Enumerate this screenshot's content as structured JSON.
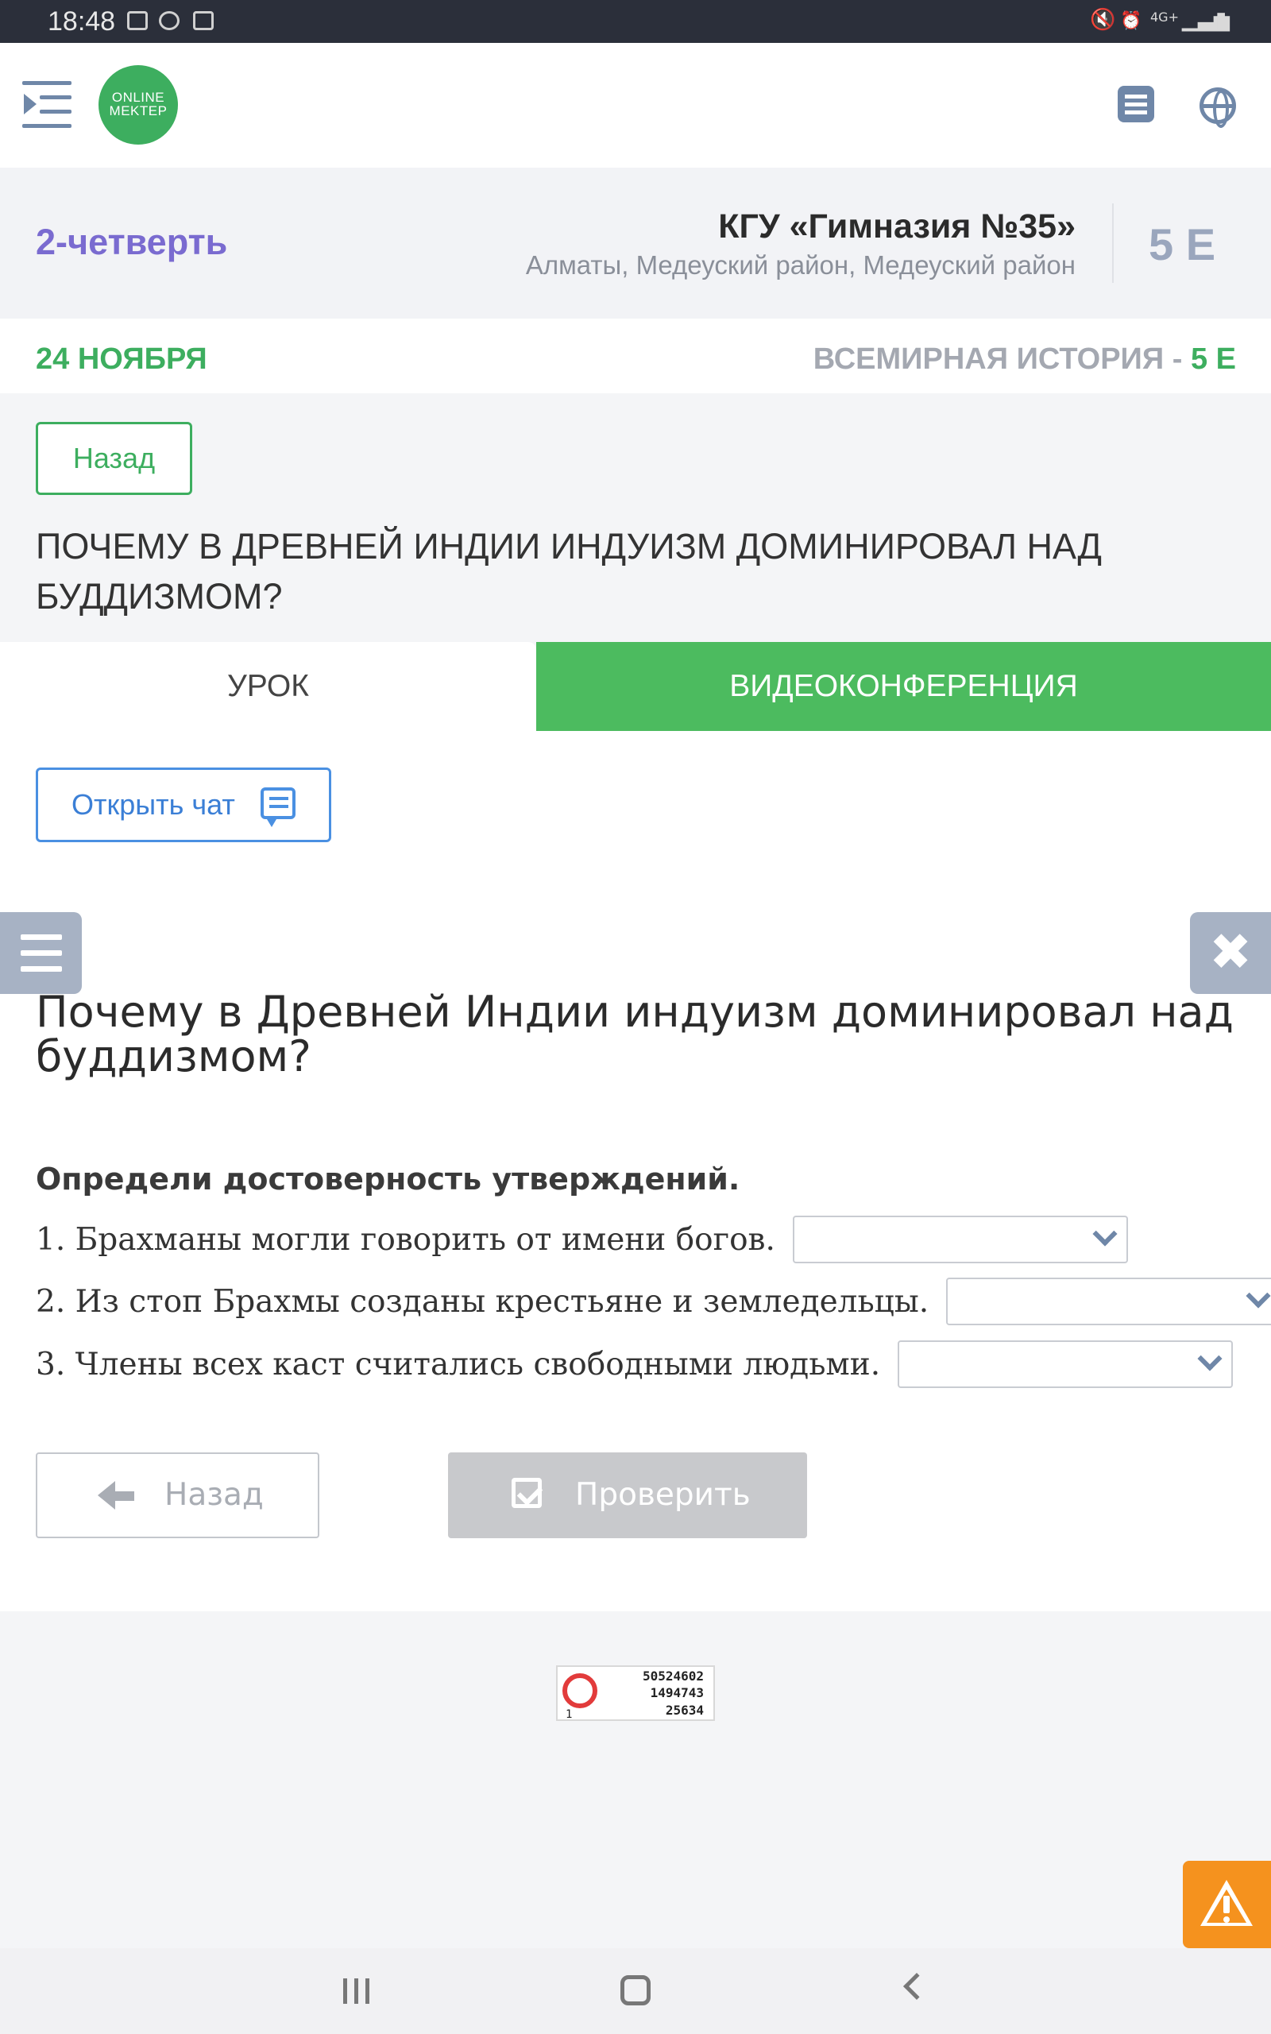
{
  "status_bar": {
    "time": "18:48",
    "network_label": "4G+"
  },
  "header": {
    "logo_text_line1": "ONLINE",
    "logo_text_line2": "MEKTEP"
  },
  "school": {
    "quarter": "2-четверть",
    "name": "КГУ «Гимназия №35»",
    "address": "Алматы, Медеуский район, Медеуский район",
    "class": "5 Е"
  },
  "lesson_info": {
    "date": "24 НОЯБРЯ",
    "subject": "ВСЕМИРНАЯ ИСТОРИЯ",
    "subject_sep": " - ",
    "subject_class": "5 Е"
  },
  "back_button_label": "Назад",
  "lesson_title": "ПОЧЕМУ В ДРЕВНЕЙ ИНДИИ ИНДУИЗМ ДОМИНИРОВАЛ НАД БУДДИЗМОМ?",
  "tabs": [
    {
      "label": "УРОК",
      "active": true
    },
    {
      "label": "ВИДЕОКОНФЕРЕНЦИЯ",
      "active": false
    }
  ],
  "chat_button_label": "Открыть чат",
  "close_glyph": "✖",
  "task": {
    "title": "Почему в Древней Индии индуизм доминировал над буддизмом?",
    "instruction": "Определи достоверность утверждений.",
    "statements": [
      {
        "text": "1. Брахманы могли говорить от имени богов.",
        "selected": ""
      },
      {
        "text": "2. Из стоп Брахмы созданы крестьяне и земледельцы.",
        "selected": ""
      },
      {
        "text": "3. Члены всех каст считались свободными людьми.",
        "selected": ""
      }
    ],
    "back_label": "Назад",
    "check_label": "Проверить"
  },
  "stamp": {
    "line1": "50524602",
    "line2": "1494743",
    "line3": "25634",
    "corner": "1"
  },
  "colors": {
    "green": "#3dae5f",
    "purple": "#7a6bd0",
    "blue": "#4a90e2",
    "orange": "#f5921e",
    "slate": "#6f87a8"
  }
}
